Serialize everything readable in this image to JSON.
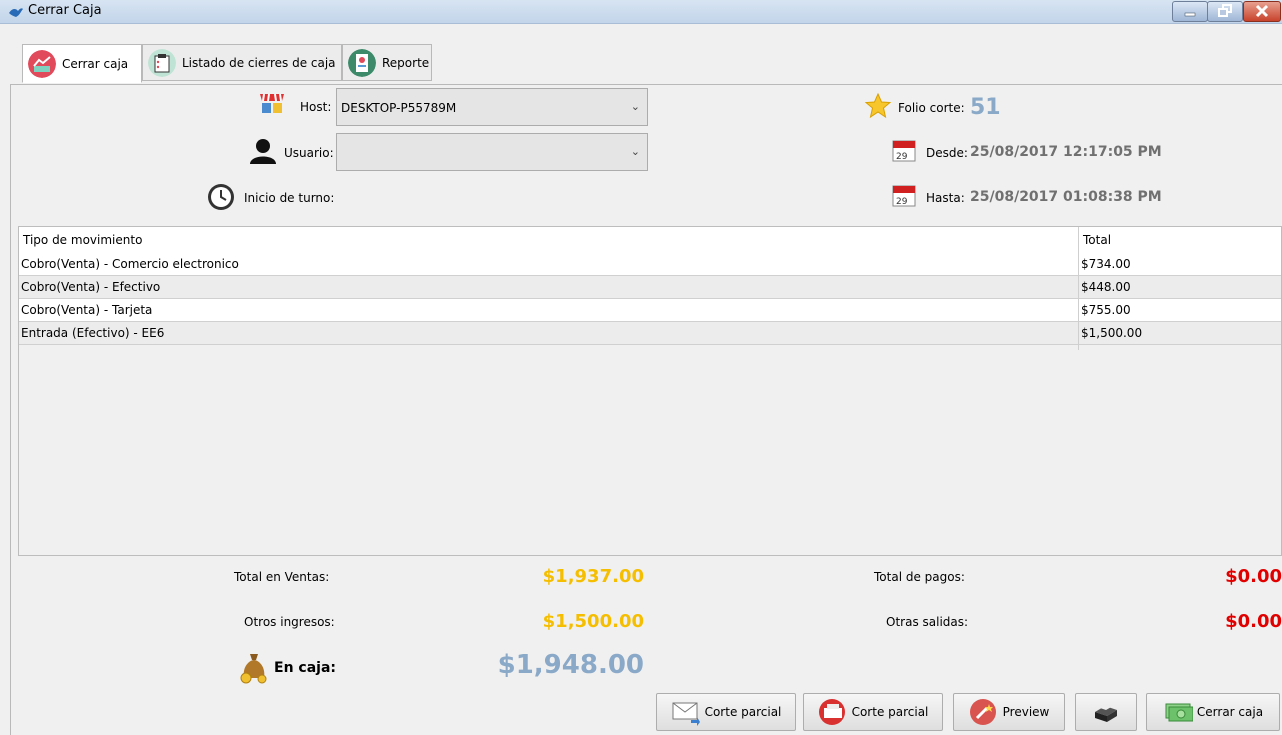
{
  "window": {
    "title": "Cerrar Caja"
  },
  "tabs": [
    {
      "label": "Cerrar caja",
      "active": true,
      "icon": "chart-icon"
    },
    {
      "label": "Listado de cierres de caja",
      "active": false,
      "icon": "clipboard-icon"
    },
    {
      "label": "Reporte",
      "active": false,
      "icon": "report-icon"
    }
  ],
  "form": {
    "host_label": "Host:",
    "host_value": "DESKTOP-P55789M",
    "usuario_label": "Usuario:",
    "usuario_value": "",
    "inicio_label": "Inicio de turno:"
  },
  "info": {
    "folio_label": "Folio corte:",
    "folio_value": "51",
    "desde_label": "Desde:",
    "desde_value": "25/08/2017 12:17:05 PM",
    "hasta_label": "Hasta:",
    "hasta_value": "25/08/2017 01:08:38 PM"
  },
  "table": {
    "columns": [
      "Tipo de movimiento",
      "Total"
    ],
    "rows": [
      [
        "Cobro(Venta) - Comercio electronico",
        "$734.00"
      ],
      [
        "Cobro(Venta) - Efectivo",
        "$448.00"
      ],
      [
        "Cobro(Venta) - Tarjeta",
        "$755.00"
      ],
      [
        "Entrada (Efectivo) - EE6",
        "$1,500.00"
      ]
    ]
  },
  "summary": {
    "ventas_label": "Total en Ventas:",
    "ventas_value": "$1,937.00",
    "otros_ingresos_label": "Otros ingresos:",
    "otros_ingresos_value": "$1,500.00",
    "en_caja_label": "En caja:",
    "en_caja_value": "$1,948.00",
    "pagos_label": "Total de pagos:",
    "pagos_value": "$0.00",
    "salidas_label": "Otras salidas:",
    "salidas_value": "$0.00"
  },
  "buttons": {
    "corte_parcial_1": "Corte parcial",
    "corte_parcial_2": "Corte parcial",
    "preview": "Preview",
    "cerrar_caja": "Cerrar caja"
  },
  "colors": {
    "income": "#f5be00",
    "expense": "#e00000",
    "balance": "#8aa9c8",
    "folio": "#8aa9c8"
  }
}
